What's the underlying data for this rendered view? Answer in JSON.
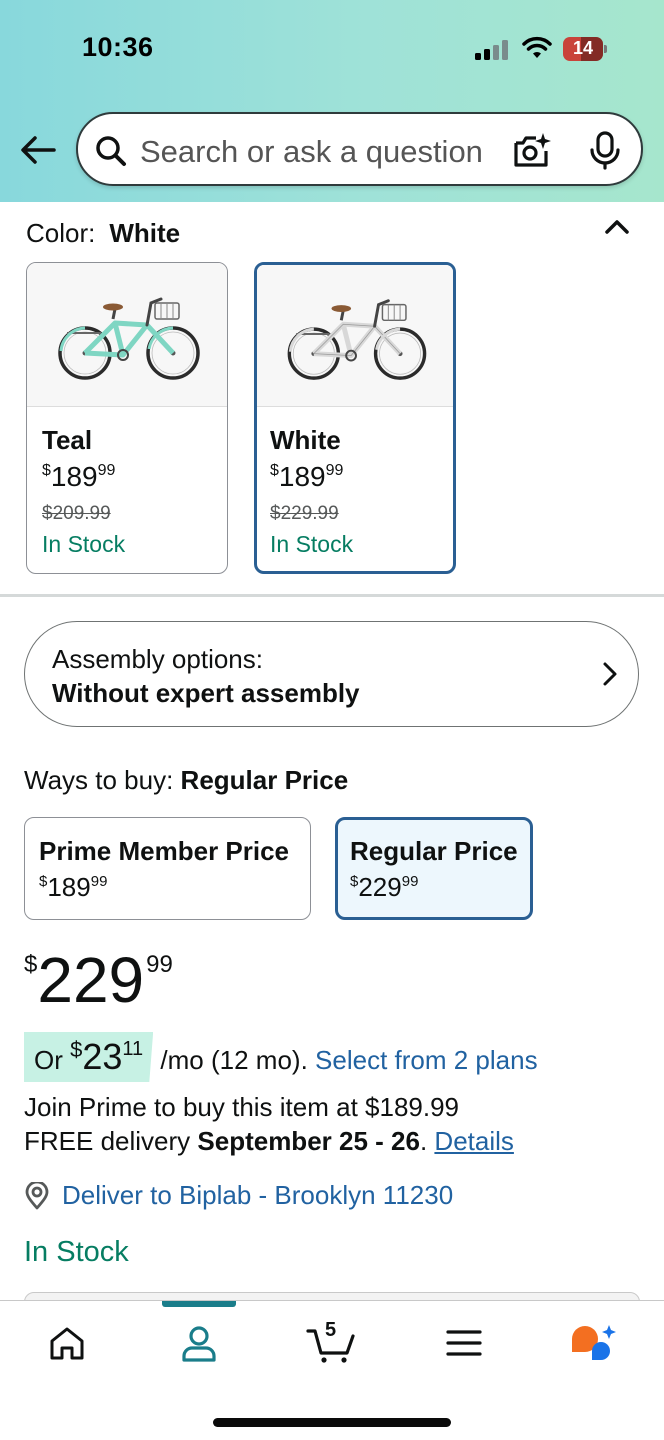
{
  "status_bar": {
    "time": "10:36",
    "battery": "14"
  },
  "search": {
    "placeholder": "Search or ask a question"
  },
  "color_section": {
    "label": "Color:",
    "selected": "White",
    "options": [
      {
        "name": "Teal",
        "price_whole": "189",
        "price_cents": "99",
        "currency": "$",
        "was_price": "$209.99",
        "stock": "In Stock",
        "frame_color": "#7fd6c3"
      },
      {
        "name": "White",
        "price_whole": "189",
        "price_cents": "99",
        "currency": "$",
        "was_price": "$229.99",
        "stock": "In Stock",
        "frame_color": "#f2f2f2"
      }
    ]
  },
  "assembly": {
    "label": "Assembly options:",
    "value": "Without expert assembly"
  },
  "ways_to_buy": {
    "label": "Ways to buy:",
    "selected": "Regular Price",
    "options": [
      {
        "title": "Prime Member Price",
        "currency": "$",
        "whole": "189",
        "cents": "99"
      },
      {
        "title": "Regular Price",
        "currency": "$",
        "whole": "229",
        "cents": "99"
      }
    ]
  },
  "price": {
    "currency": "$",
    "whole": "229",
    "cents": "99"
  },
  "monthly": {
    "prefix": "Or",
    "currency": "$",
    "whole": "23",
    "cents": "11",
    "suffix": "/mo (12 mo).",
    "link": "Select from 2 plans"
  },
  "prime_note": "Join Prime to buy this item at $189.99",
  "delivery": {
    "prefix": "FREE delivery",
    "dates": "September 25 - 26",
    "period": ".",
    "details_link": "Details"
  },
  "deliver_to": "Deliver to Biplab - Brooklyn 11230",
  "in_stock": "In Stock",
  "bottom_nav": {
    "cart_count": "5",
    "items": [
      "home-icon",
      "account-icon",
      "cart-icon",
      "menu-icon",
      "rufus-icon"
    ]
  },
  "colors": {
    "header_gradient": [
      "#88d8dc",
      "#a6e6cd"
    ],
    "selected_border": "#2a5f93",
    "link": "#2162a1",
    "stock_green": "#067d62",
    "teal_accent": "#1a7d8a"
  }
}
